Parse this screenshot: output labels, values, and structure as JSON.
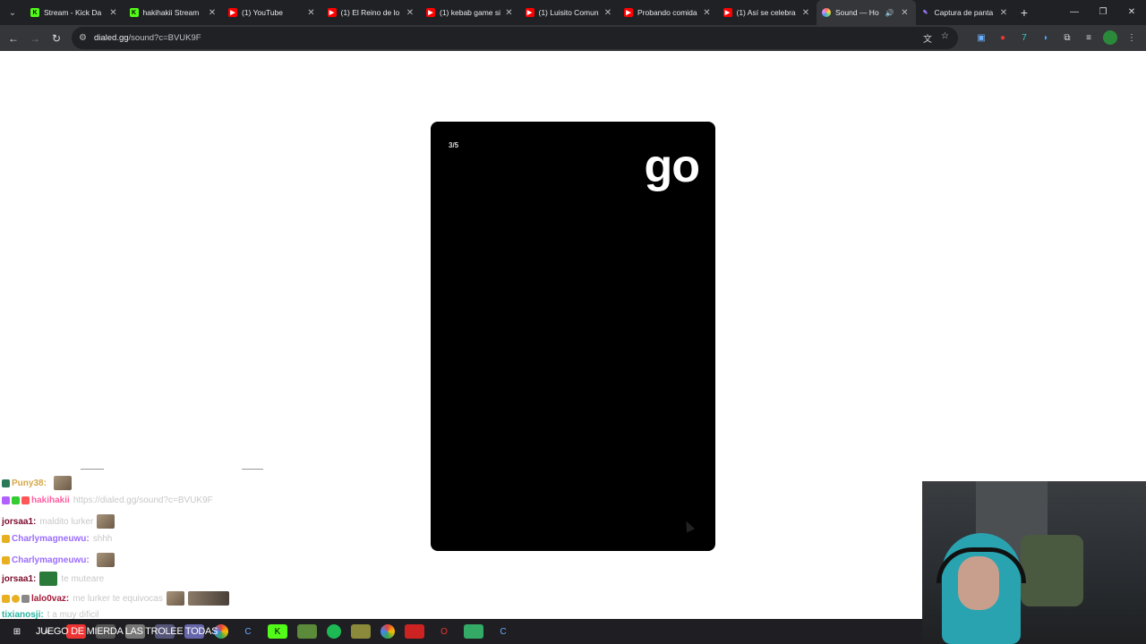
{
  "browser": {
    "tabs": [
      {
        "title": "Stream - Kick Da",
        "icon": "kick-icon",
        "color": "#53fc18"
      },
      {
        "title": "hakihakii Stream",
        "icon": "kick-icon",
        "color": "#53fc18"
      },
      {
        "title": "(1) YouTube",
        "icon": "youtube-icon",
        "color": "#ff0000"
      },
      {
        "title": "(1) El Reino de lo",
        "icon": "youtube-icon",
        "color": "#ff0000"
      },
      {
        "title": "(1) kebab game si",
        "icon": "youtube-icon",
        "color": "#ff0000"
      },
      {
        "title": "(1) Luisito Comun",
        "icon": "youtube-icon",
        "color": "#ff0000"
      },
      {
        "title": "Probando comida",
        "icon": "youtube-icon",
        "color": "#ff0000"
      },
      {
        "title": "(1) Así se celebra",
        "icon": "youtube-icon",
        "color": "#ff0000"
      },
      {
        "title": "Sound — Ho",
        "icon": "dialed-icon",
        "color": "#e48cff",
        "active": true
      },
      {
        "title": "Captura de panta",
        "icon": "feather-icon",
        "color": "#9c7bff"
      }
    ],
    "url_host": "dialed.gg",
    "url_path": "/sound?c=BVUK9F"
  },
  "game": {
    "progress": "3/5",
    "word": "go"
  },
  "chat": {
    "messages": [
      {
        "user": "Puny38:",
        "text": "",
        "color": "#d6a84a",
        "emote": "emote"
      },
      {
        "user": "hakihakii",
        "text": "https://dialed.gg/sound?c=BVUK9F",
        "color": "#ff5fa2",
        "emote": ""
      },
      {
        "user": "jorsaa1:",
        "text": "maldito lurker",
        "color": "#7a0a2a",
        "emote": "emote"
      },
      {
        "user": "Charlymagneuwu:",
        "text": "shhh",
        "color": "#9b6cff",
        "emote": ""
      },
      {
        "user": "Charlymagneuwu:",
        "text": "",
        "color": "#9b6cff",
        "emote": "emote"
      },
      {
        "user": "jorsaa1:",
        "text": "te muteare",
        "color": "#7a0a2a",
        "emote": "emote"
      },
      {
        "user": "lalo0vaz:",
        "text": "me lurker te equivocas",
        "color": "#a51a3a",
        "emote": "emote-wide"
      },
      {
        "user": "tixianosji:",
        "text": "t a muy dificil",
        "color": "#2bb5a0",
        "emote": ""
      }
    ]
  },
  "taskbar": {
    "title": "JUEGO DE MIERDA LAS TROLEE TODAS"
  }
}
